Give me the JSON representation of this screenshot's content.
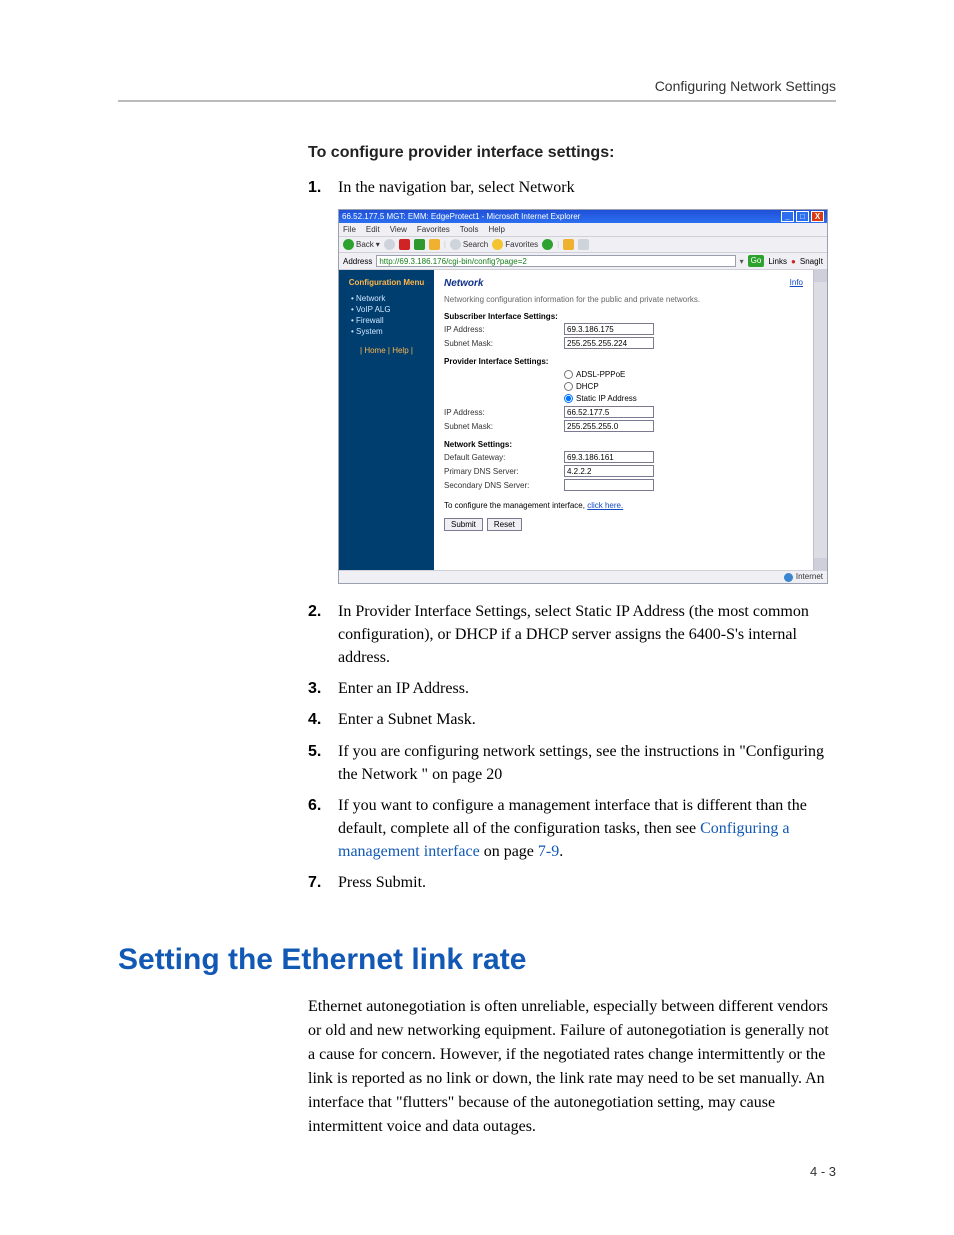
{
  "running_header": "Configuring Network Settings",
  "section_title": "To configure provider interface settings:",
  "steps": {
    "s1_num": "1.",
    "s1_body": "In the navigation bar, select Network",
    "s2_num": "2.",
    "s2_body": "In Provider Interface Settings, select Static IP Address (the most common configuration), or DHCP if a DHCP server assigns the 6400-S's internal address.",
    "s3_num": "3.",
    "s3_body": "Enter an IP Address.",
    "s4_num": "4.",
    "s4_body": "Enter a Subnet Mask.",
    "s5_num": "5.",
    "s5_body": "If you are configuring network settings, see the instructions in \"Configuring the Network \" on page 20",
    "s6_num": "6.",
    "s6_pre": "If you want to configure a management interface that is different than the default, complete all of the configuration tasks, then see ",
    "s6_link": "Configuring a management interface",
    "s6_mid": " on page ",
    "s6_page": "7-9",
    "s6_post": ".",
    "s7_num": "7.",
    "s7_body": "Press Submit."
  },
  "h1": "Setting the Ethernet link rate",
  "body_para": "Ethernet autonegotiation is often unreliable, especially between different vendors or old and new networking equipment. Failure of autonegotiation is generally not a cause for concern. However, if the negotiated rates change intermittently or the link is reported as no link or down, the link rate may need to be set manually. An interface that \"flutters\" because of the autonegotiation setting, may cause intermittent voice and data outages.",
  "footer": "4 - 3",
  "shot": {
    "title": "66.52.177.5 MGT: EMM: EdgeProtect1 - Microsoft Internet Explorer",
    "win_min": "_",
    "win_max": "□",
    "win_close": "X",
    "menu": {
      "file": "File",
      "edit": "Edit",
      "view": "View",
      "favorites": "Favorites",
      "tools": "Tools",
      "help": "Help"
    },
    "toolbar": {
      "back": "Back",
      "search": "Search",
      "favorites": "Favorites"
    },
    "address_label": "Address",
    "address_value": "http://69.3.186.176/cgi-bin/config?page=2",
    "go": "Go",
    "links": "Links",
    "snagit": "SnagIt",
    "sidebar": {
      "heading": "Configuration Menu",
      "items": {
        "network": "Network",
        "voipalg": "VoIP ALG",
        "firewall": "Firewall",
        "system": "System"
      },
      "homehelp": "| Home | Help |"
    },
    "main": {
      "title": "Network",
      "info": "Info",
      "desc": "Networking configuration information for the public and private networks.",
      "sub_if": "Subscriber Interface Settings:",
      "ip_label": "IP Address:",
      "sub_ip": "69.3.186.175",
      "mask_label": "Subnet Mask:",
      "sub_mask": "255.255.255.224",
      "prov_if": "Provider Interface Settings:",
      "radio_adsl": "ADSL-PPPoE",
      "radio_dhcp": "DHCP",
      "radio_static": "Static IP Address",
      "prov_ip": "66.52.177.5",
      "prov_mask": "255.255.255.0",
      "net_settings": "Network Settings:",
      "gw_label": "Default Gateway:",
      "gw": "69.3.186.161",
      "dns1_label": "Primary DNS Server:",
      "dns1": "4.2.2.2",
      "dns2_label": "Secondary DNS Server:",
      "dns2": "",
      "mgmt_pre": "To configure the management interface, ",
      "mgmt_link": "click here.",
      "submit": "Submit",
      "reset": "Reset"
    },
    "status_left": "",
    "status_right": "Internet"
  }
}
